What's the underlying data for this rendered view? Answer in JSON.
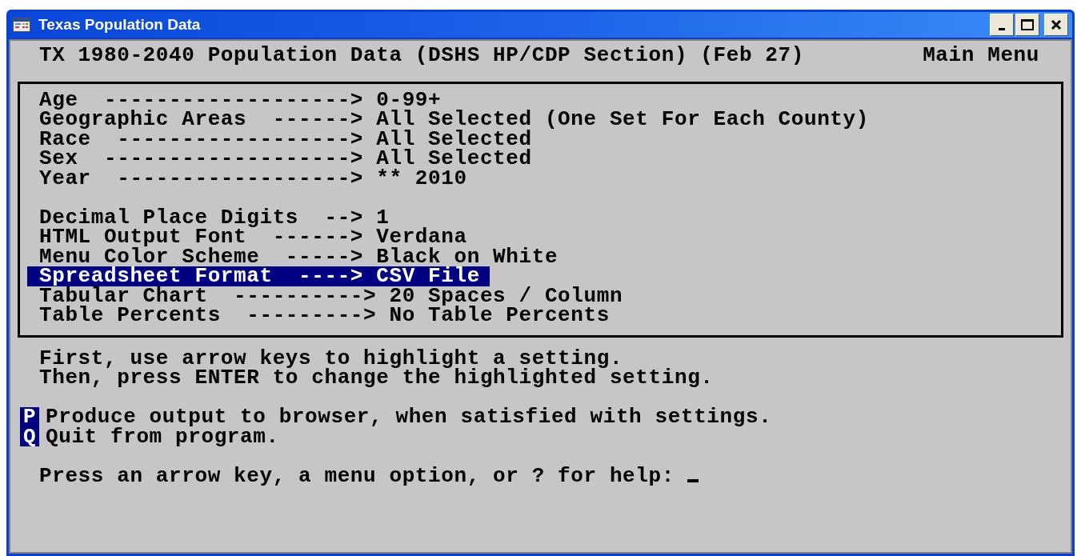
{
  "window": {
    "title": "Texas Population Data"
  },
  "header": {
    "title": "TX 1980-2040 Population Data (DSHS HP/CDP Section) (Feb 27)",
    "menu": "Main Menu"
  },
  "setting_groups": [
    {
      "rows": [
        {
          "label": "Age",
          "arrow": "------------------->",
          "value": "0-99+",
          "selected": false
        },
        {
          "label": "Geographic Areas",
          "arrow": "------>",
          "value": "All Selected (One Set For Each County)",
          "selected": false
        },
        {
          "label": "Race",
          "arrow": "------------------>",
          "value": "All Selected",
          "selected": false
        },
        {
          "label": "Sex",
          "arrow": "------------------->",
          "value": "All Selected",
          "selected": false
        },
        {
          "label": "Year",
          "arrow": "------------------>",
          "value": "** 2010",
          "selected": false
        }
      ]
    },
    {
      "rows": [
        {
          "label": "Decimal Place Digits",
          "arrow": "-->",
          "value": "1",
          "selected": false
        },
        {
          "label": "HTML Output Font",
          "arrow": "------>",
          "value": "Verdana",
          "selected": false
        },
        {
          "label": "Menu Color Scheme",
          "arrow": "----->",
          "value": "Black on White",
          "selected": false
        },
        {
          "label": "Spreadsheet Format",
          "arrow": "---->",
          "value": "CSV File",
          "selected": true
        },
        {
          "label": "Tabular Chart",
          "arrow": "---------->",
          "value": "20 Spaces / Column",
          "selected": false
        },
        {
          "label": "Table Percents",
          "arrow": "--------->",
          "value": "No Table Percents",
          "selected": false
        }
      ]
    }
  ],
  "instructions": [
    "First, use arrow keys to highlight a setting.",
    "Then, press ENTER to change the highlighted setting."
  ],
  "options": [
    {
      "key": "P",
      "text": "Produce output to browser, when satisfied with settings."
    },
    {
      "key": "Q",
      "text": "Quit from program."
    }
  ],
  "prompt": "Press an arrow key, a menu option, or ? for help:"
}
